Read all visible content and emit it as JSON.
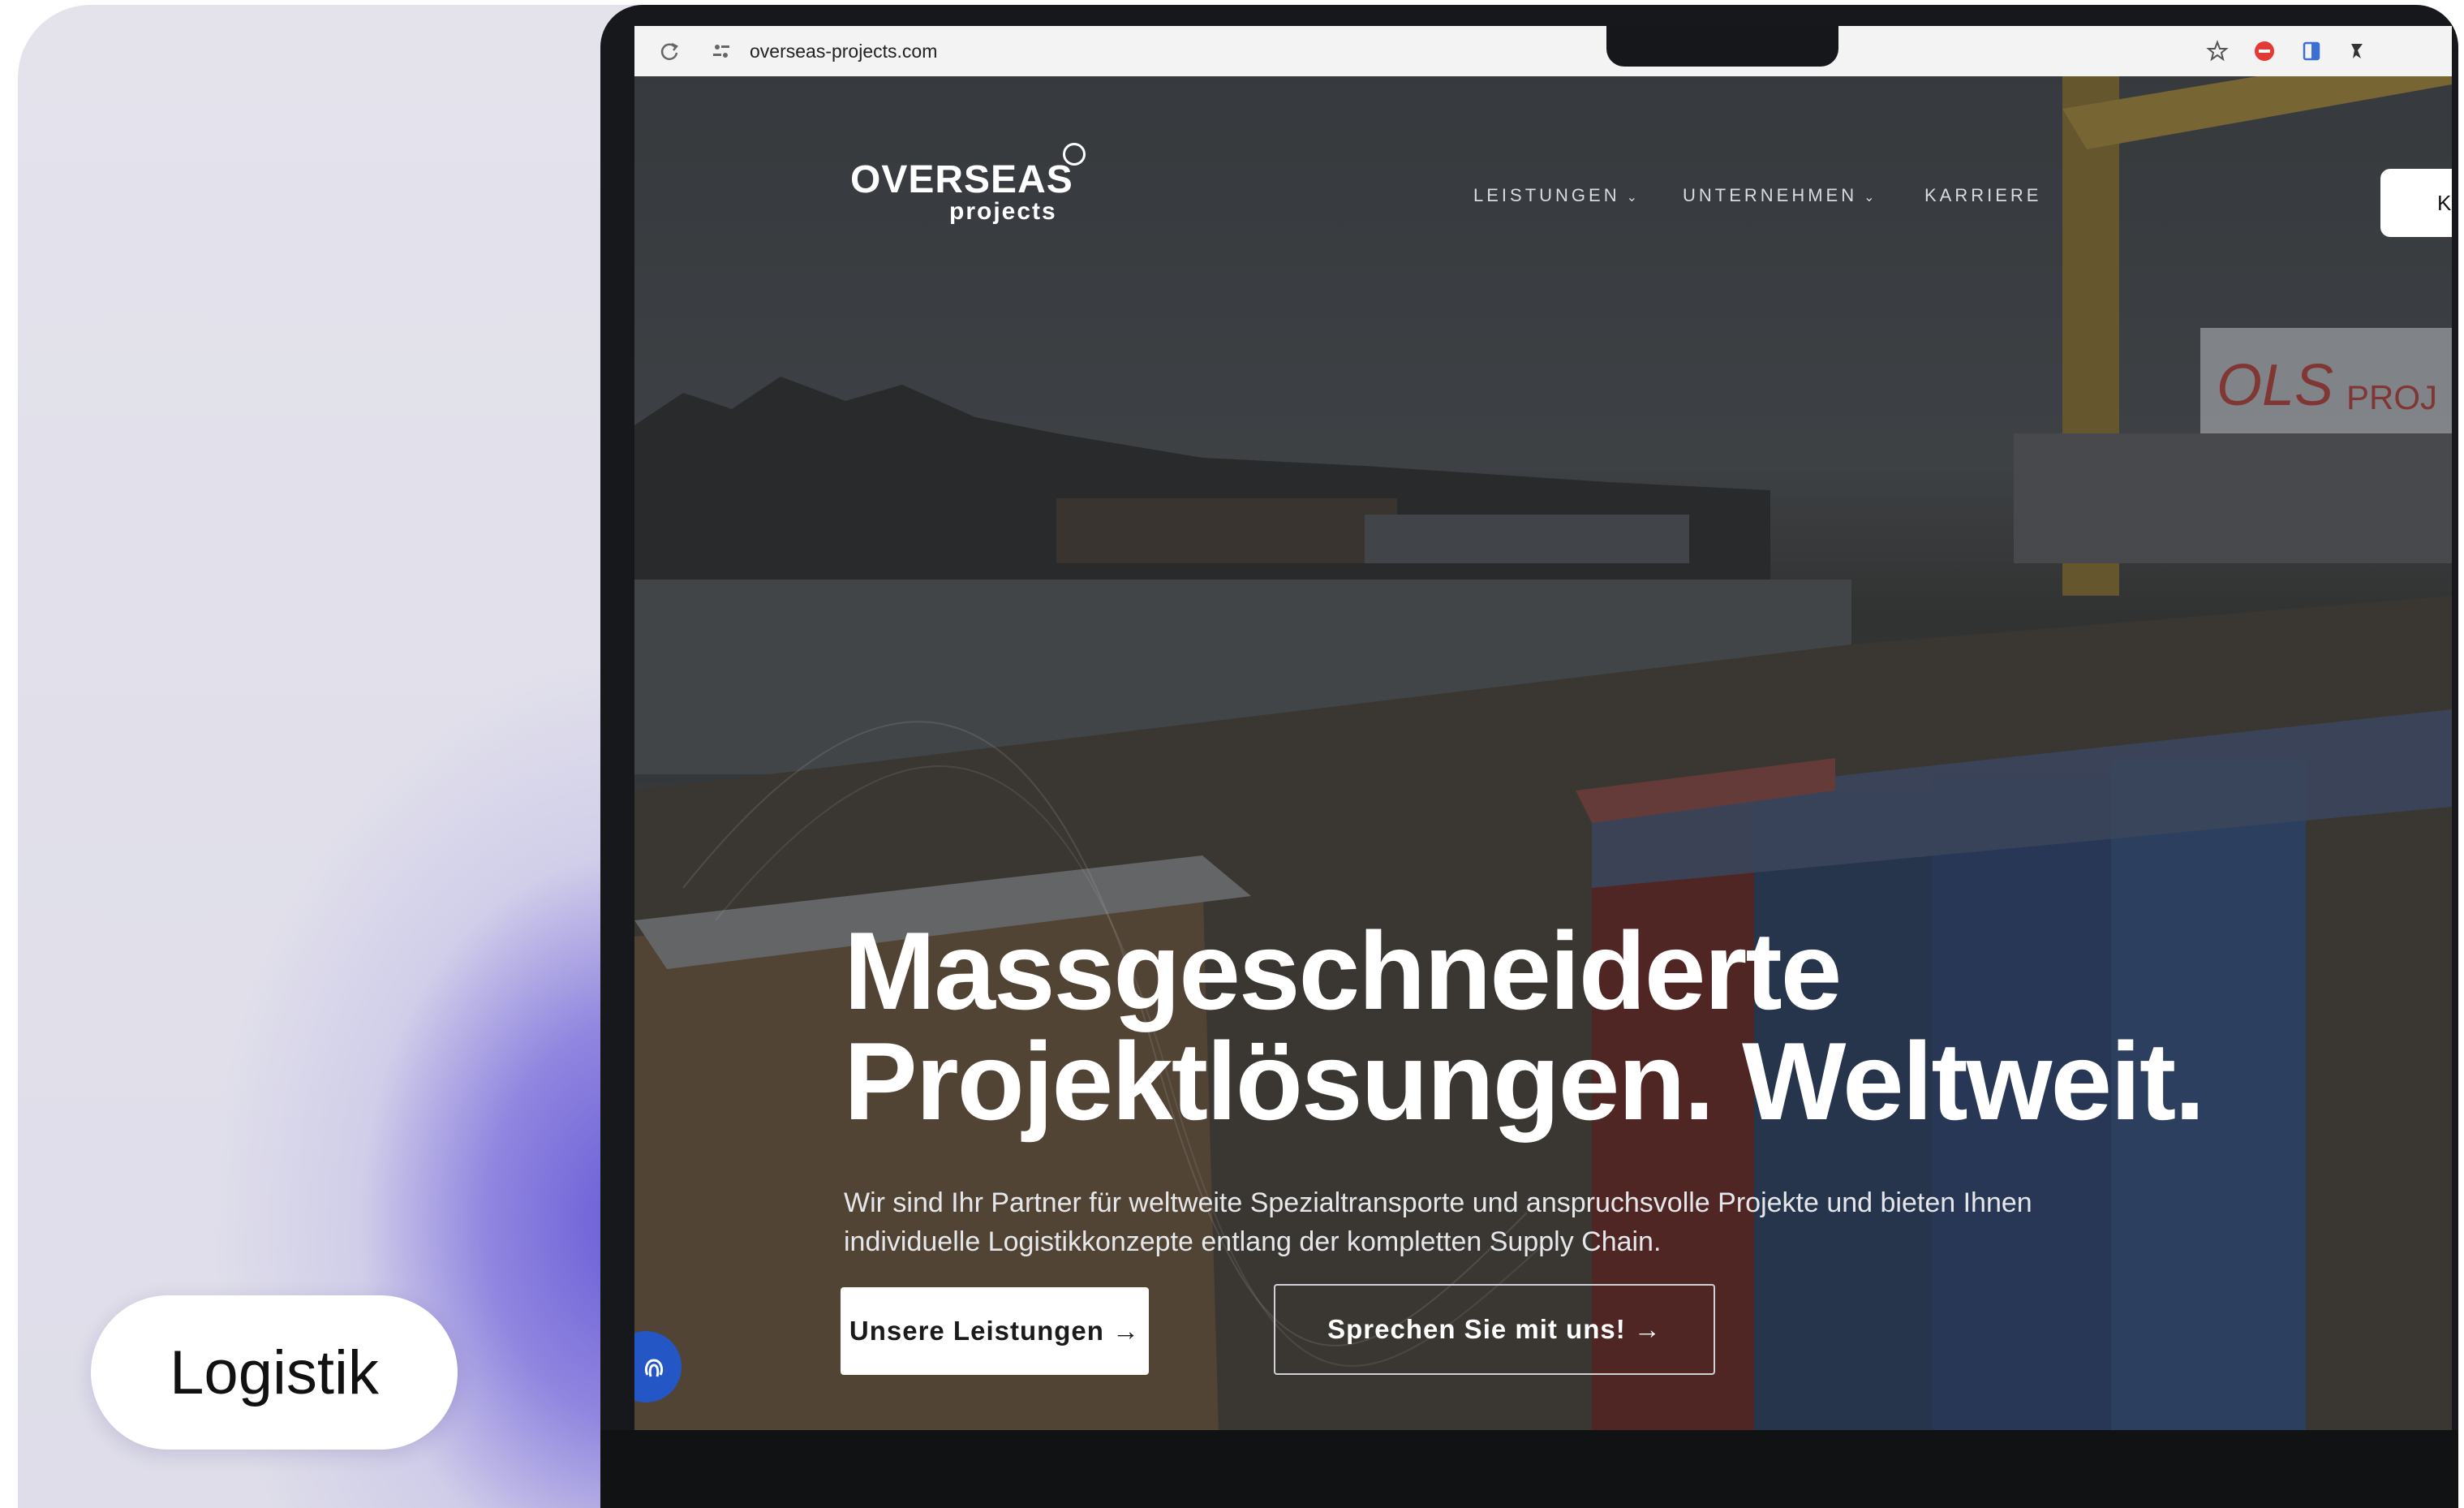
{
  "tag": {
    "label": "Logistik"
  },
  "browser": {
    "url": "overseas-projects.com",
    "icons": [
      "reload-icon",
      "site-settings-icon",
      "star-icon",
      "adblock-icon",
      "sidebar-icon",
      "extensions-icon"
    ]
  },
  "site": {
    "logo": {
      "main": "OVERSEAS",
      "sub": "projects"
    },
    "nav": [
      {
        "label": "LEISTUNGEN",
        "has_dropdown": true
      },
      {
        "label": "UNTERNEHMEN",
        "has_dropdown": true
      },
      {
        "label": "KARRIERE",
        "has_dropdown": false
      }
    ],
    "header_cta_label": "K",
    "hero": {
      "line1": "Massgeschneiderte",
      "line2_part1": "Projektlösungen.",
      "line2_highlight": "Weltweit.",
      "subtitle": "Wir sind Ihr Partner für weltweite Spezialtransporte und anspruchsvolle Projekte und bieten Ihnen individuelle Logistikkonzepte entlang der kompletten Supply Chain.",
      "primary_button": "Unsere Leistungen →",
      "secondary_button": "Sprechen Sie mit uns! →"
    },
    "crane_sign": "OLS PROJ"
  },
  "colors": {
    "accent_purple": "#6154d6",
    "highlight_blue": "#1e4aa8",
    "fingerprint_button": "#2457c5"
  }
}
